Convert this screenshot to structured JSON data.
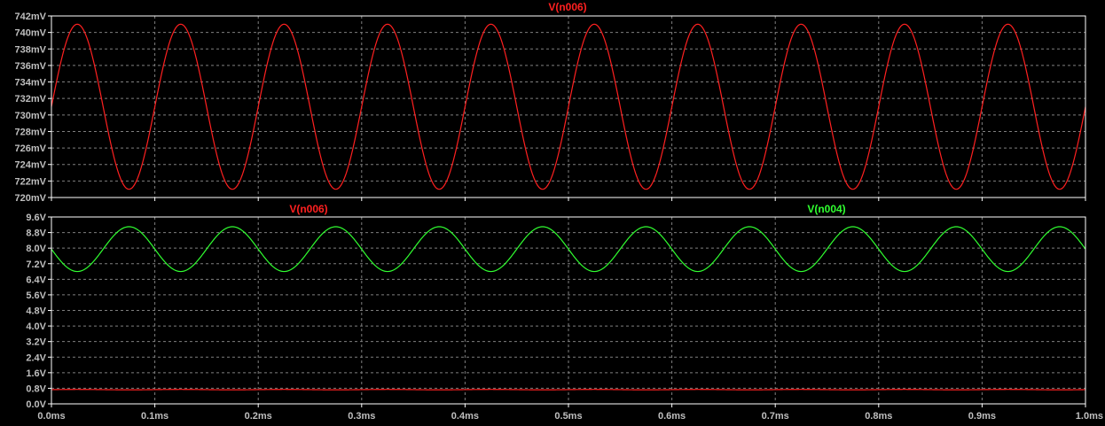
{
  "colors": {
    "background": "#000000",
    "grid": "#7f7f7f",
    "axis": "#ffffff",
    "tick_label": "#bfbfbf",
    "red_trace": "#ff2020",
    "green_trace": "#30ff30"
  },
  "chart_data": [
    {
      "type": "line",
      "title": "V(n006)",
      "xlabel": "",
      "ylabel": "",
      "x_unit": "ms",
      "xlim": [
        0.0,
        1.0
      ],
      "x_ticks": [
        0.0,
        0.1,
        0.2,
        0.3,
        0.4,
        0.5,
        0.6,
        0.7,
        0.8,
        0.9,
        1.0
      ],
      "x_tick_labels": [
        "0.0ms",
        "0.1ms",
        "0.2ms",
        "0.3ms",
        "0.4ms",
        "0.5ms",
        "0.6ms",
        "0.7ms",
        "0.8ms",
        "0.9ms",
        "1.0ms"
      ],
      "ylim": [
        720,
        742
      ],
      "y_unit": "mV",
      "y_ticks": [
        720,
        722,
        724,
        726,
        728,
        730,
        732,
        734,
        736,
        738,
        740,
        742
      ],
      "y_tick_labels": [
        "720mV",
        "722mV",
        "724mV",
        "726mV",
        "728mV",
        "730mV",
        "732mV",
        "734mV",
        "736mV",
        "738mV",
        "740mV",
        "742mV"
      ],
      "grid": true,
      "legend": "top-center",
      "series": [
        {
          "name": "V(n006)",
          "color": "#ff2020",
          "waveform": "sine",
          "offset": 731,
          "amplitude": 10,
          "frequency_khz": 10,
          "phase_deg": 0
        }
      ]
    },
    {
      "type": "line",
      "title": "",
      "xlabel": "",
      "ylabel": "",
      "x_unit": "ms",
      "xlim": [
        0.0,
        1.0
      ],
      "x_ticks": [
        0.0,
        0.1,
        0.2,
        0.3,
        0.4,
        0.5,
        0.6,
        0.7,
        0.8,
        0.9,
        1.0
      ],
      "x_tick_labels": [
        "0.0ms",
        "0.1ms",
        "0.2ms",
        "0.3ms",
        "0.4ms",
        "0.5ms",
        "0.6ms",
        "0.7ms",
        "0.8ms",
        "0.9ms",
        "1.0ms"
      ],
      "ylim": [
        0,
        9.6
      ],
      "y_unit": "V",
      "y_ticks": [
        0,
        0.8,
        1.6,
        2.4,
        3.2,
        4.0,
        4.8,
        5.6,
        6.4,
        7.2,
        8.0,
        8.8,
        9.6
      ],
      "y_tick_labels": [
        "0.0V",
        "0.8V",
        "1.6V",
        "2.4V",
        "3.2V",
        "4.0V",
        "4.8V",
        "5.6V",
        "6.4V",
        "7.2V",
        "8.0V",
        "8.8V",
        "9.6V"
      ],
      "grid": true,
      "legend": "top",
      "series": [
        {
          "name": "V(n006)",
          "color": "#ff2020",
          "waveform": "sine",
          "offset": 0.731,
          "amplitude": 0.01,
          "frequency_khz": 10,
          "phase_deg": 0
        },
        {
          "name": "V(n004)",
          "color": "#30ff30",
          "waveform": "sine",
          "offset": 7.95,
          "amplitude": 1.15,
          "frequency_khz": 10,
          "phase_deg": 180
        }
      ]
    }
  ]
}
